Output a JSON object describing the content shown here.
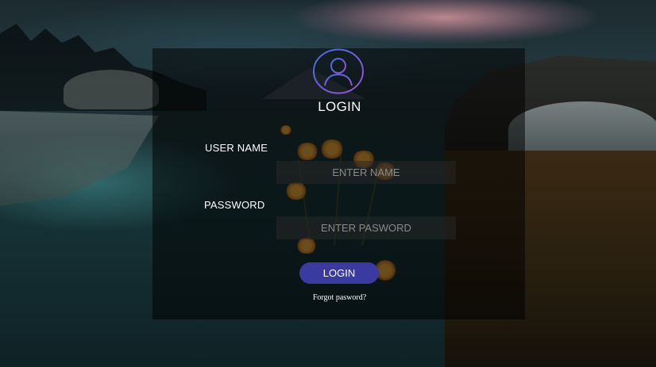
{
  "login": {
    "title": "LOGIN",
    "username": {
      "label": "USER NAME",
      "placeholder": "ENTER NAME",
      "value": ""
    },
    "password": {
      "label": "PASSWORD",
      "placeholder": "ENTER PASWORD",
      "value": ""
    },
    "submit_label": "LOGIN",
    "forgot_label": "Forgot pasword?",
    "avatar_icon": "user-circle-icon"
  },
  "colors": {
    "panel_overlay": "#000000",
    "button": "#3b3aa0",
    "avatar_ring_start": "#3f6fe0",
    "avatar_ring_end": "#9b4fd8",
    "text": "#ffffff",
    "placeholder": "#8a8a8a"
  }
}
